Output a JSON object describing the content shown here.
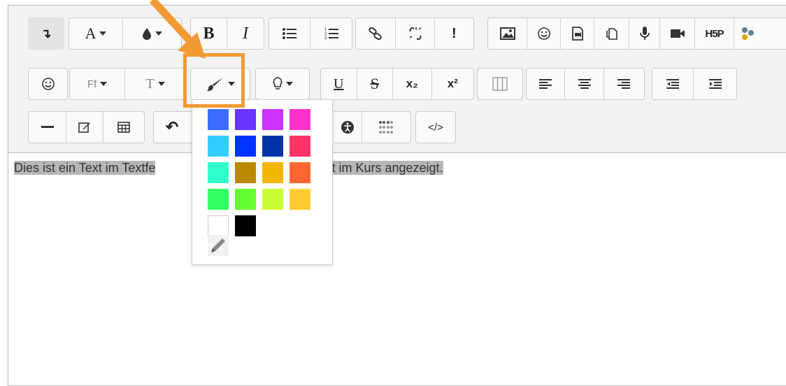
{
  "toolbar": {
    "row1": {
      "collapse": "↴",
      "font_color_letter": "A",
      "bold": "B",
      "italic": "I",
      "h5p": "H5P"
    },
    "row2": {
      "font_family": "Ff",
      "font_size": "T",
      "underline": "U",
      "strike": "S",
      "subscript": "x₂",
      "superscript": "x²"
    },
    "row3": {
      "undo": "↶",
      "html": "</>"
    }
  },
  "editor": {
    "visible_text_left": "Dies ist ein Text im Textfe",
    "visible_text_right": "d direkt im Kurs angezeigt."
  },
  "palette": {
    "colors": [
      [
        "#3a6cff",
        "#6633ff",
        "#cc33ff",
        "#ff33cc"
      ],
      [
        "#33ccff",
        "#0033ff",
        "#0033aa",
        "#ff3366"
      ],
      [
        "#33ffcc",
        "#bb8800",
        "#f3b600",
        "#ff6633"
      ],
      [
        "#33ff66",
        "#66ff33",
        "#ccff33",
        "#ffcc33"
      ],
      [
        "#ffffff",
        "#000000"
      ]
    ],
    "custom_color_icon": "pencil-icon"
  },
  "annotation": {
    "color": "#f29a33"
  }
}
